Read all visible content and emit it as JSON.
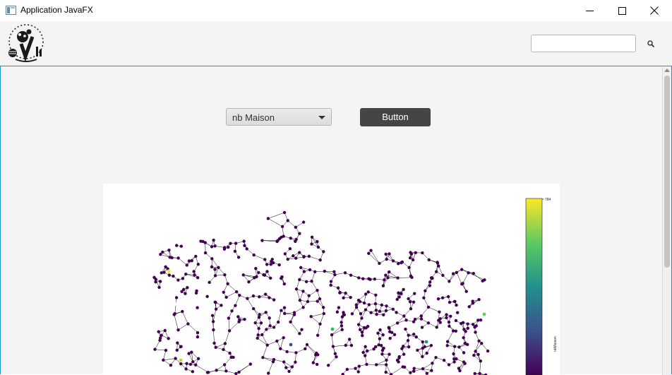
{
  "window": {
    "title": "Application JavaFX",
    "icon": "app-window-icon",
    "controls": {
      "minimize": "minimize-icon",
      "maximize": "maximize-icon",
      "close": "close-icon"
    }
  },
  "header": {
    "logo": "logo-icon",
    "search": {
      "value": "",
      "placeholder": "",
      "icon": "search-icon"
    }
  },
  "controls": {
    "combo_value": "nb Maison",
    "button_label": "Button"
  },
  "plot": {
    "type": "network-graph",
    "colorbar": {
      "max_label": "784",
      "axis_label": "nbMaison",
      "colors": [
        "#fde725",
        "#5ec962",
        "#21918c",
        "#3b528b",
        "#440154"
      ]
    },
    "node_color": "#440154",
    "edge_color": "#000000"
  },
  "accent_color": "#1e90d8"
}
